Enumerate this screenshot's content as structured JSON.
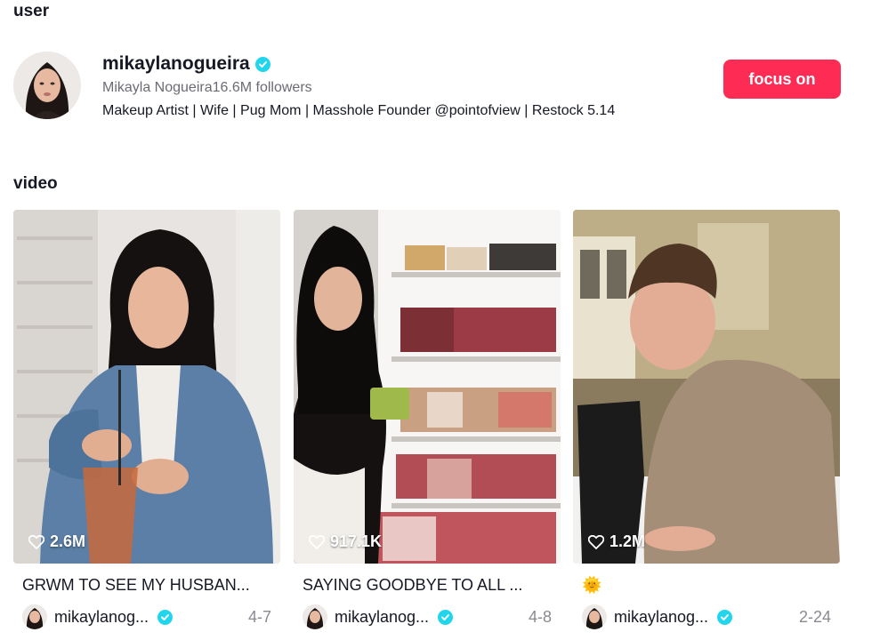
{
  "sections": {
    "user": "user",
    "video": "video"
  },
  "user": {
    "username": "mikaylanogueira",
    "display_name": "Mikayla Nogueira",
    "followers": "16.6M followers",
    "bio": "Makeup Artist | Wife | Pug Mom | Masshole Founder @pointofview | Restock 5.14",
    "follow_label": "focus on"
  },
  "videos": [
    {
      "likes": "2.6M",
      "caption": "GRWM TO SEE MY HUSBAN...",
      "author": "mikaylanog...",
      "date": "4-7"
    },
    {
      "likes": "917.1K",
      "caption": "SAYING GOODBYE TO ALL ...",
      "author": "mikaylanog...",
      "date": "4-8"
    },
    {
      "likes": "1.2M",
      "caption": "🌞",
      "author": "mikaylanog...",
      "date": "2-24"
    }
  ],
  "colors": {
    "accent": "#fe2c55",
    "verified": "#20d5ec",
    "muted": "#8a8b91"
  },
  "icons": {
    "verified": "verified-badge-icon",
    "likes": "heart-icon"
  }
}
